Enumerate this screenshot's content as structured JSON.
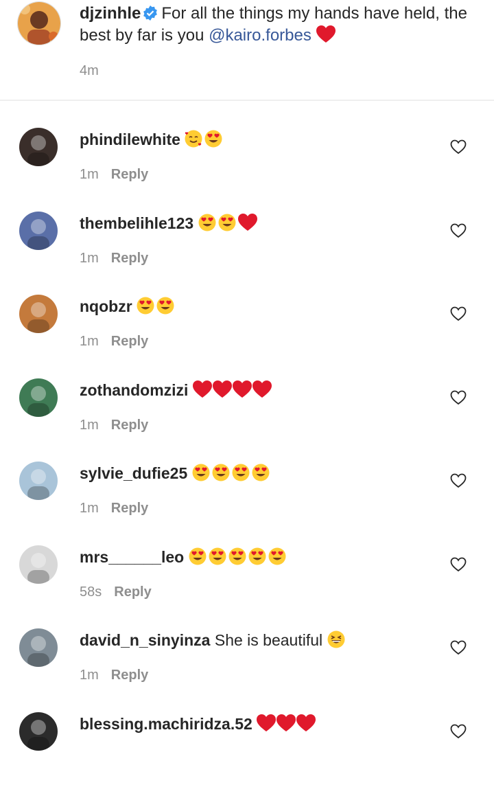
{
  "caption": {
    "username": "djzinhle",
    "text_part1": "For all the things my hands have held, the best by far is you ",
    "mention": "@kairo.forbes",
    "emojis": [
      "red-heart"
    ],
    "time": "4m",
    "avatar_color": "#b0542c"
  },
  "reply_label": "Reply",
  "comments": [
    {
      "username": "phindilewhite",
      "text": "",
      "emojis": [
        "smiling-face-with-hearts",
        "heart-eyes"
      ],
      "time": "1m",
      "avatar_color": "#3a2e2a"
    },
    {
      "username": "thembelihle123",
      "text": "",
      "emojis": [
        "heart-eyes",
        "heart-eyes",
        "red-heart"
      ],
      "time": "1m",
      "avatar_color": "#5a6fa8"
    },
    {
      "username": "nqobzr",
      "text": "",
      "emojis": [
        "heart-eyes",
        "heart-eyes"
      ],
      "time": "1m",
      "avatar_color": "#c47a3c"
    },
    {
      "username": "zothandomzizi",
      "text": "",
      "emojis": [
        "red-heart",
        "red-heart",
        "red-heart",
        "red-heart"
      ],
      "time": "1m",
      "avatar_color": "#3f7b55"
    },
    {
      "username": "sylvie_dufie25",
      "text": "",
      "emojis": [
        "heart-eyes",
        "heart-eyes",
        "heart-eyes",
        "heart-eyes"
      ],
      "time": "1m",
      "avatar_color": "#a9c4d9"
    },
    {
      "username": "mrs______leo",
      "text": "",
      "emojis": [
        "heart-eyes",
        "heart-eyes",
        "heart-eyes",
        "heart-eyes",
        "heart-eyes"
      ],
      "time": "58s",
      "avatar_color": "#d8d8d8"
    },
    {
      "username": "david_n_sinyinza",
      "text": "She is beautiful",
      "emojis": [
        "grinning-squinting"
      ],
      "time": "1m",
      "avatar_color": "#7f8c96"
    },
    {
      "username": "blessing.machiridza.52",
      "text": "",
      "emojis": [
        "red-heart",
        "red-heart",
        "red-heart"
      ],
      "time": "",
      "avatar_color": "#2b2b2b"
    }
  ]
}
